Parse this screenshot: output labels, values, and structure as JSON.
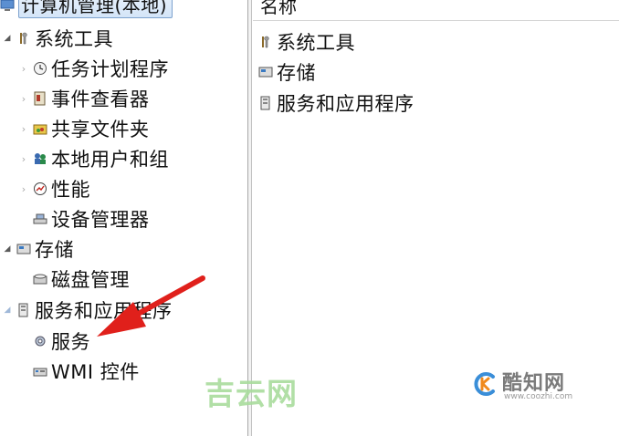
{
  "tree": {
    "root": {
      "label": "计算机管理(本地)"
    },
    "system_tools": {
      "label": "系统工具",
      "children": [
        {
          "label": "任务计划程序"
        },
        {
          "label": "事件查看器"
        },
        {
          "label": "共享文件夹"
        },
        {
          "label": "本地用户和组"
        },
        {
          "label": "性能"
        },
        {
          "label": "设备管理器"
        }
      ]
    },
    "storage": {
      "label": "存储",
      "children": [
        {
          "label": "磁盘管理"
        }
      ]
    },
    "services_apps": {
      "label": "服务和应用程序",
      "children": [
        {
          "label": "服务"
        },
        {
          "label": "WMI 控件"
        }
      ]
    }
  },
  "list": {
    "column_name": "名称",
    "items": [
      {
        "label": "系统工具"
      },
      {
        "label": "存储"
      },
      {
        "label": "服务和应用程序"
      }
    ]
  },
  "watermarks": {
    "jiyun": "吉云网",
    "kuzhi_title": "酷知网",
    "kuzhi_url": "www.coozhi.com"
  },
  "colors": {
    "selection_border": "#7da2ce",
    "arrow": "#e0201b",
    "watermark_green": "#a9dc9d"
  }
}
